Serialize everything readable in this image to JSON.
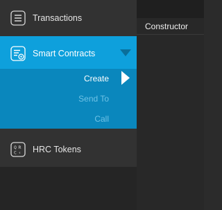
{
  "sidebar": {
    "items": [
      {
        "label": "Transactions",
        "icon": "transactions-icon"
      },
      {
        "label": "Smart Contracts",
        "icon": "smart-contracts-icon",
        "active": true
      },
      {
        "label": "HRC Tokens",
        "icon": "qrc-tokens-icon"
      }
    ],
    "submenu": [
      {
        "label": "Create",
        "active": true
      },
      {
        "label": "Send To"
      },
      {
        "label": "Call"
      }
    ]
  },
  "content": {
    "tab_title": "Constructor"
  },
  "colors": {
    "accent": "#0ea0dc",
    "submenu_bg": "#0a87bd",
    "sidebar_bg": "#323232"
  }
}
